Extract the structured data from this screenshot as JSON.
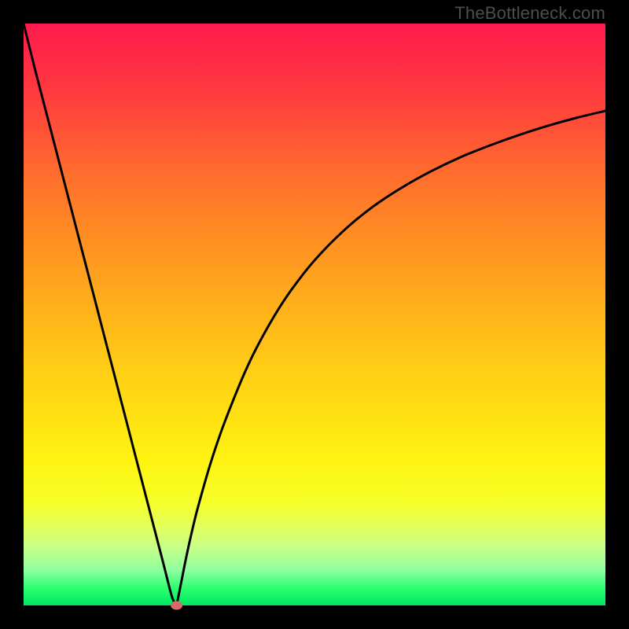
{
  "watermark": "TheBottleneck.com",
  "chart_data": {
    "type": "line",
    "title": "",
    "xlabel": "",
    "ylabel": "",
    "xlim": [
      0,
      100
    ],
    "ylim": [
      0,
      100
    ],
    "series": [
      {
        "name": "left-branch",
        "x": [
          0,
          2,
          4,
          6,
          8,
          10,
          12,
          14,
          16,
          18,
          20,
          22,
          24,
          25.5,
          26.3
        ],
        "values": [
          100,
          92,
          84.3,
          76.6,
          68.9,
          61.2,
          53.5,
          45.8,
          38.1,
          30.4,
          22.7,
          15.0,
          7.3,
          1.5,
          0
        ]
      },
      {
        "name": "right-branch",
        "x": [
          26.3,
          27,
          28,
          29,
          30,
          32,
          34,
          36,
          38,
          40,
          43,
          46,
          50,
          55,
          60,
          65,
          70,
          75,
          80,
          85,
          90,
          95,
          100
        ],
        "values": [
          0,
          3.5,
          8.5,
          13,
          17,
          24,
          30,
          35.2,
          40,
          44.2,
          49.6,
          54.2,
          59.3,
          64.4,
          68.5,
          71.8,
          74.6,
          77.0,
          79.0,
          80.8,
          82.4,
          83.8,
          85.0
        ]
      }
    ],
    "marker": {
      "x": 26.3,
      "y": 0,
      "color": "#d86a6a"
    },
    "gradient_colors": {
      "top": "#ff1a4d",
      "bottom": "#00e860"
    }
  }
}
